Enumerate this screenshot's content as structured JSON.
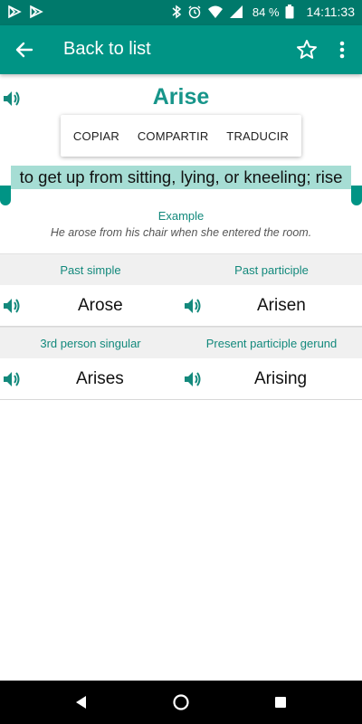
{
  "status_bar": {
    "battery": "84 %",
    "time": "14:11:33"
  },
  "app_bar": {
    "title": "Back to list",
    "icons": [
      "back-arrow-icon",
      "star-outline-icon",
      "more-vert-icon"
    ]
  },
  "word": {
    "title": "Arise",
    "definition": "to get up from sitting, lying, or kneeling; rise",
    "example_label": "Example",
    "example": "He arose from his chair when she entered the room."
  },
  "context_menu": {
    "items": [
      "COPIAR",
      "COMPARTIR",
      "TRADUCIR"
    ]
  },
  "forms": {
    "row1": {
      "left_label": "Past simple",
      "right_label": "Past participle",
      "left_value": "Arose",
      "right_value": "Arisen"
    },
    "row2": {
      "left_label": "3rd person singular",
      "right_label": "Present participle gerund",
      "left_value": "Arises",
      "right_value": "Arising"
    }
  },
  "colors": {
    "status_bar": "#00796b",
    "app_bar": "#009485",
    "accent": "#17958a",
    "selection": "#a6ddd4"
  }
}
